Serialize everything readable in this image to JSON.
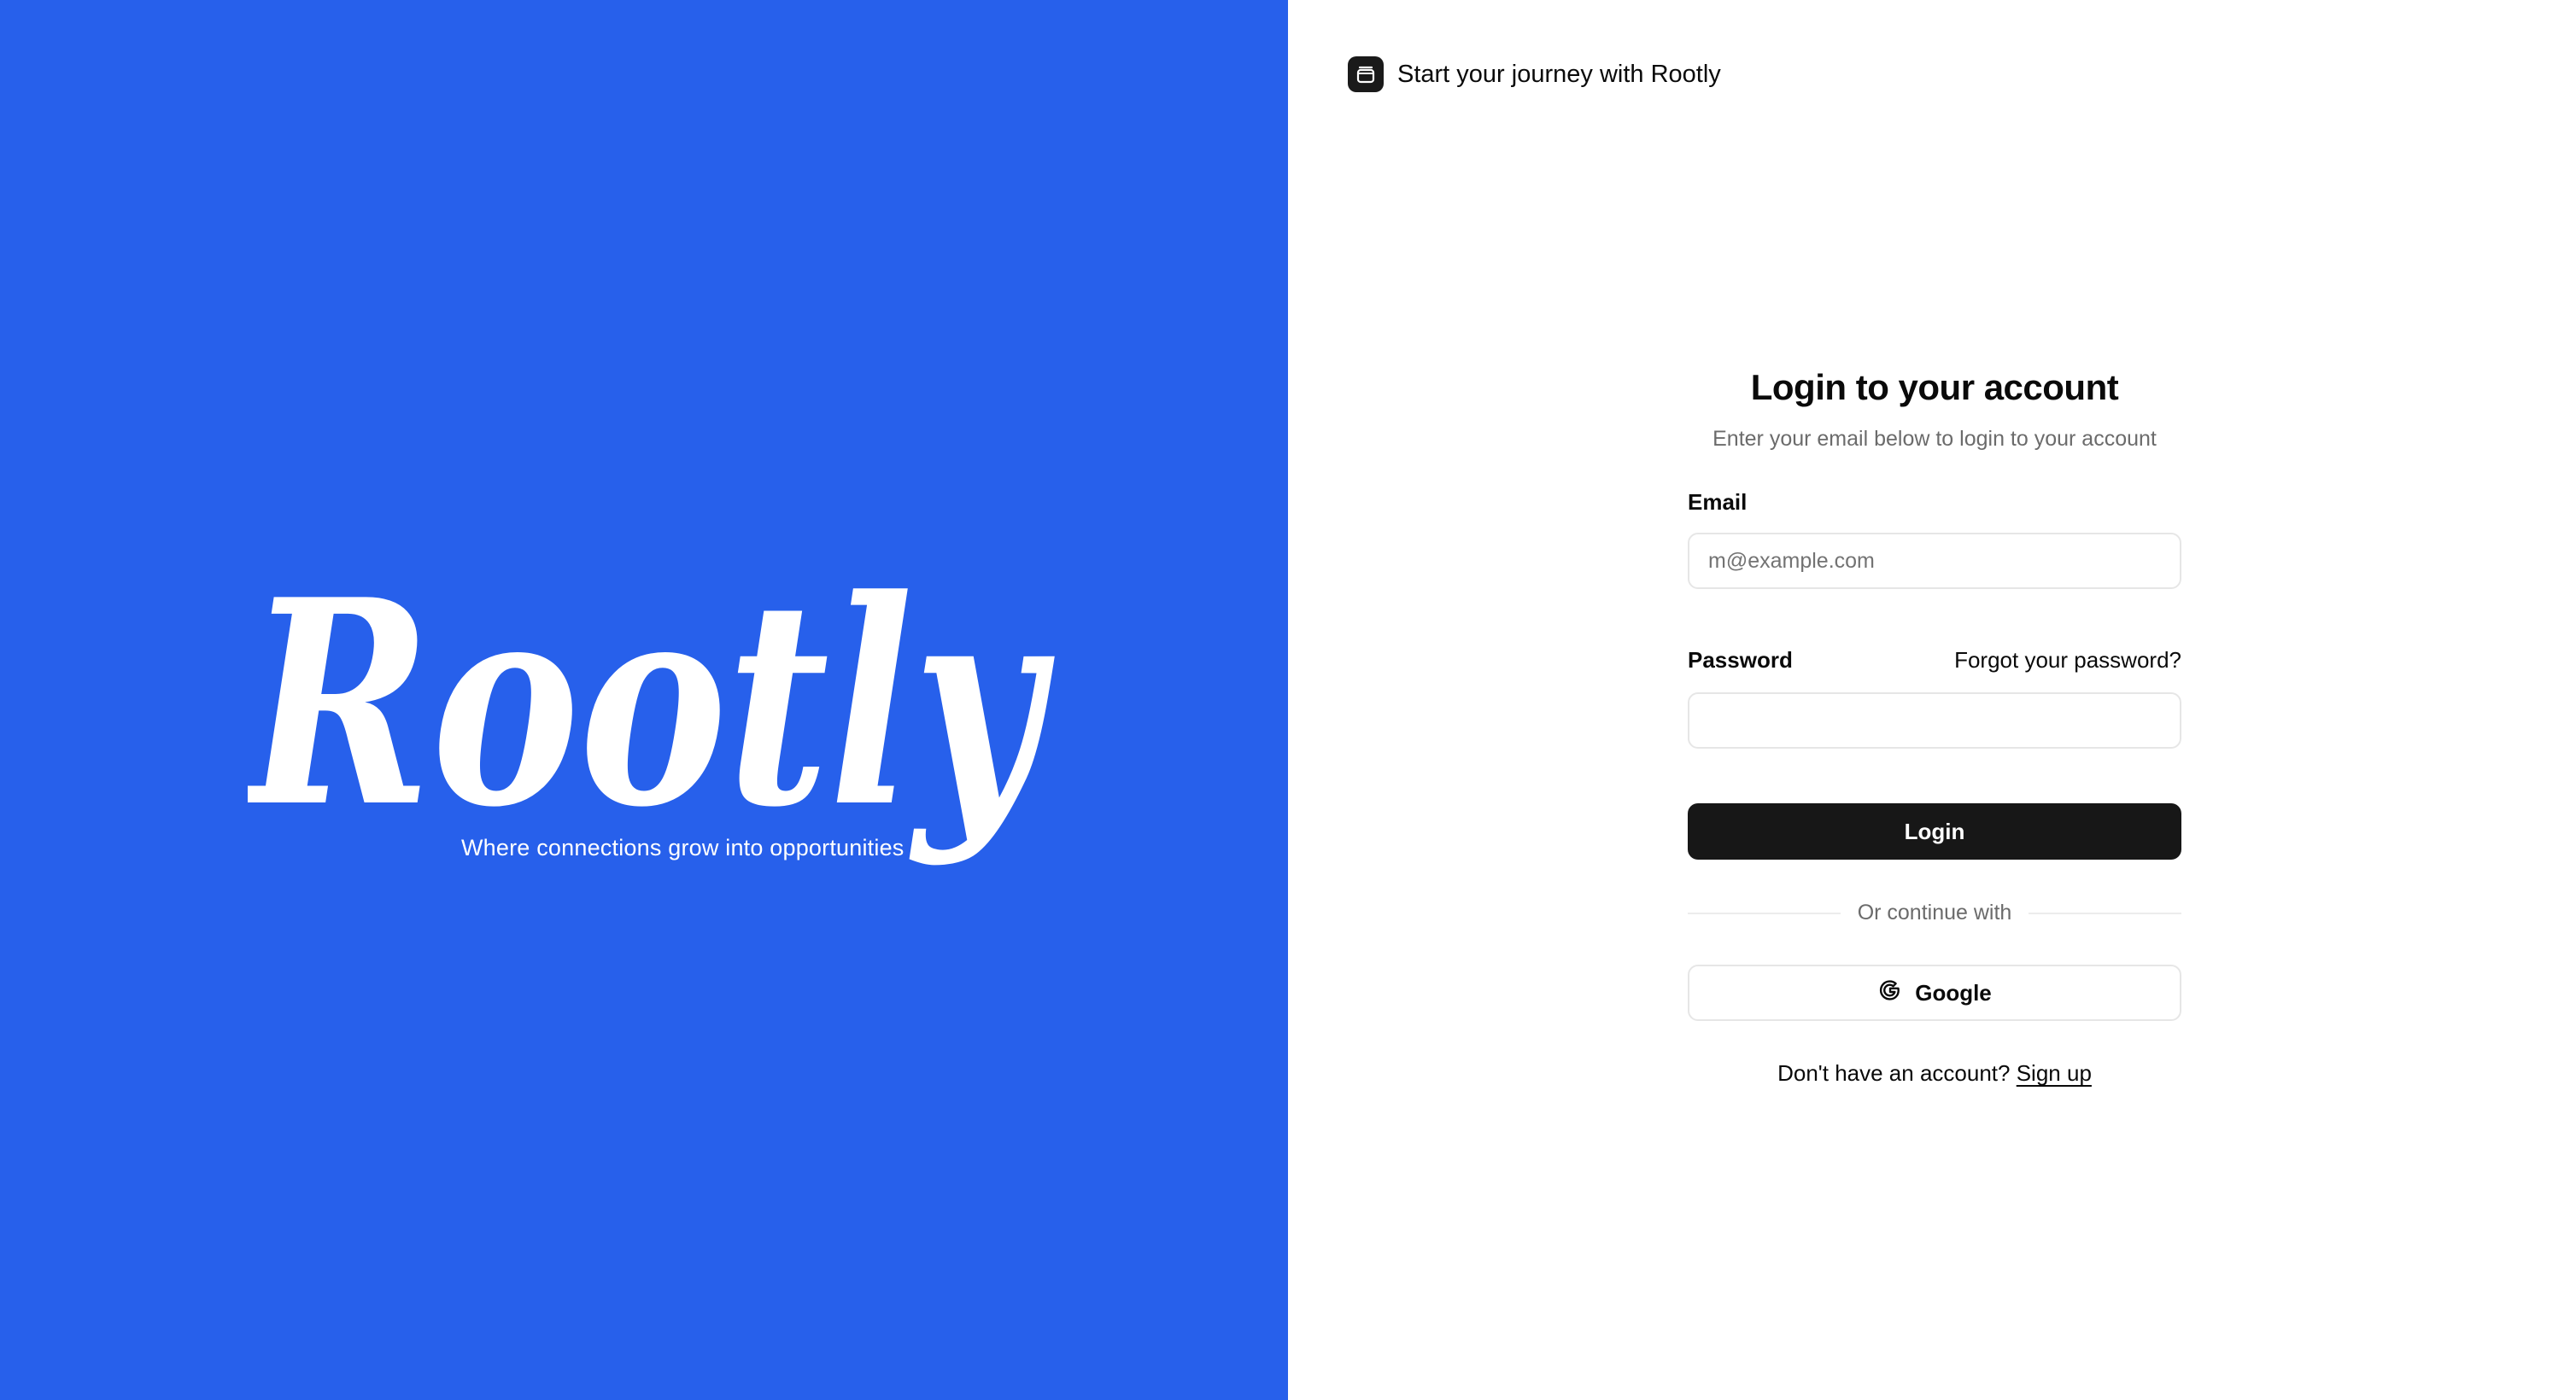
{
  "brand": {
    "logo_text": "Rootly",
    "tagline": "Where connections grow into opportunities",
    "background_color": "#2760eb"
  },
  "header": {
    "icon": "app-icon",
    "title": "Start your journey with Rootly"
  },
  "login": {
    "heading": "Login to your account",
    "subtitle": "Enter your email below to login to your account",
    "email_label": "Email",
    "email_placeholder": "m@example.com",
    "email_value": "",
    "password_label": "Password",
    "password_value": "",
    "forgot_password": "Forgot your password?",
    "login_button": "Login",
    "divider_text": "Or continue with",
    "google_button": "Google",
    "google_icon": "google-g-icon",
    "signup_prompt": "Don't have an account?",
    "signup_link": "Sign up"
  },
  "colors": {
    "primary_button": "#171717",
    "border": "#e6e6e6",
    "muted_text": "#6b6b6b"
  }
}
